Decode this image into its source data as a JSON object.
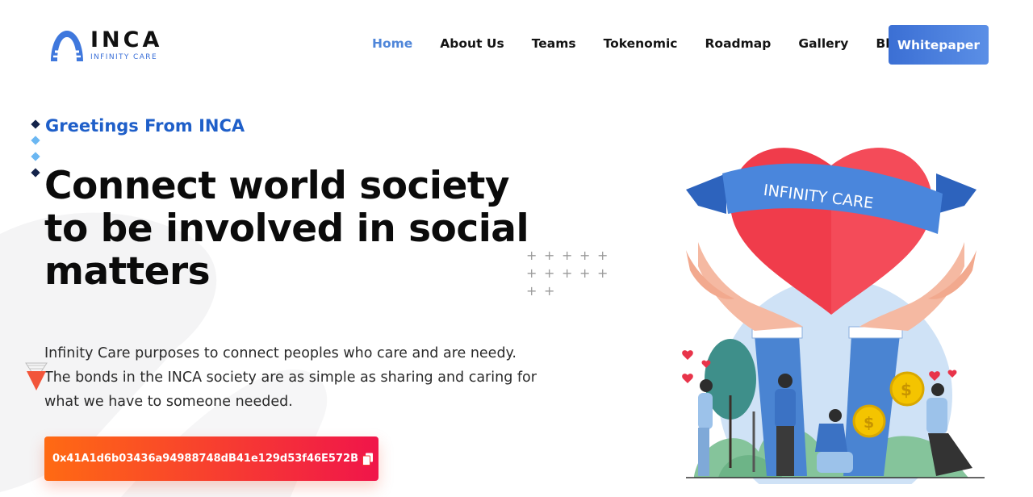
{
  "header": {
    "logo": {
      "name": "INCA",
      "tagline": "INFINITY CARE"
    },
    "nav": [
      {
        "label": "Home",
        "active": true
      },
      {
        "label": "About Us",
        "active": false
      },
      {
        "label": "Teams",
        "active": false
      },
      {
        "label": "Tokenomic",
        "active": false
      },
      {
        "label": "Roadmap",
        "active": false
      },
      {
        "label": "Gallery",
        "active": false
      },
      {
        "label": "Blog",
        "active": false
      }
    ],
    "cta_label": "Whitepaper"
  },
  "hero": {
    "greeting": "Greetings From INCA",
    "headline": "Connect world society to be involved in social matters",
    "description": "Infinity Care purposes to connect peoples who care and are needy. The bonds in the INCA society are as simple as sharing and caring for what we have to someone needed.",
    "contract_address": "0x41A1d6b03436a94988748dB41e129d53f46E572B",
    "copy_icon": "copy-icon"
  },
  "illustration": {
    "banner_text": "INFINITY CARE"
  },
  "colors": {
    "brand_blue": "#1f5fc9",
    "nav_active": "#4f86d9",
    "cta_gradient_start": "#3b6fd4",
    "contract_gradient_start": "#ff6a13",
    "contract_gradient_end": "#f0154a",
    "heart_red": "#f03c4b"
  }
}
